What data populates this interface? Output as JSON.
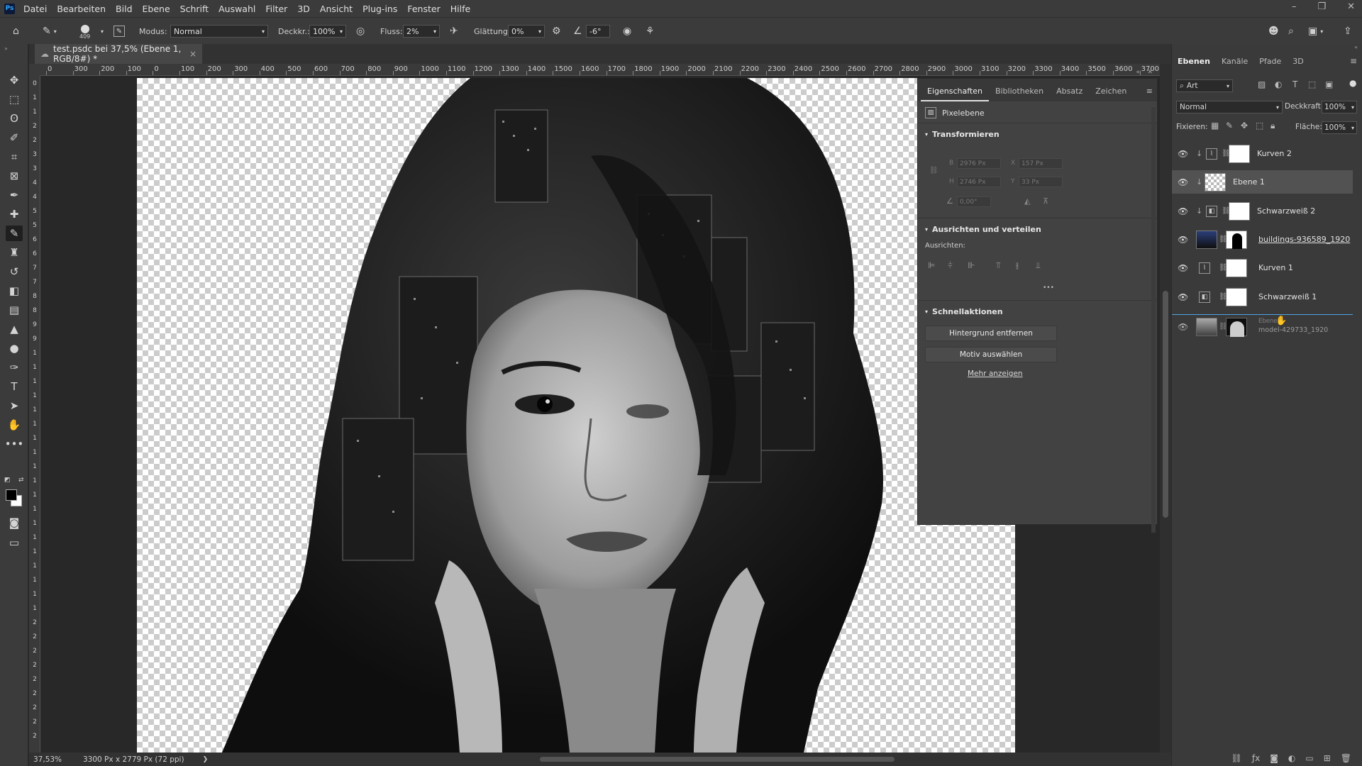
{
  "app": {
    "logo": "Ps"
  },
  "menu": [
    "Datei",
    "Bearbeiten",
    "Bild",
    "Ebene",
    "Schrift",
    "Auswahl",
    "Filter",
    "3D",
    "Ansicht",
    "Plug-ins",
    "Fenster",
    "Hilfe"
  ],
  "window_controls": [
    "–",
    "❐",
    "✕"
  ],
  "options": {
    "brush_size": "409",
    "mode_label": "Modus:",
    "mode_value": "Normal",
    "opacity_label": "Deckkr.:",
    "opacity_value": "100%",
    "flow_label": "Fluss:",
    "flow_value": "2%",
    "smoothing_label": "Glättung:",
    "smoothing_value": "0%",
    "angle_value": "-6°"
  },
  "document": {
    "tab_title": "test.psdc bei 37,5% (Ebene 1, RGB/8#) *",
    "zoom": "37,53%",
    "dimensions": "3300 Px x 2779 Px (72 ppi)"
  },
  "ruler_h": [
    "0",
    "300",
    "200",
    "100",
    "0",
    "100",
    "200",
    "300",
    "400",
    "500",
    "600",
    "700",
    "800",
    "900",
    "1000",
    "1100",
    "1200",
    "1300",
    "1400",
    "1500",
    "1600",
    "1700",
    "1800",
    "1900",
    "2000",
    "2100",
    "2200",
    "2300",
    "2400",
    "2500",
    "2600",
    "2700",
    "2800",
    "2900",
    "3000",
    "3100",
    "3200",
    "3300",
    "3400",
    "3500",
    "3600",
    "3700"
  ],
  "ruler_v": [
    "0",
    "1",
    "1",
    "2",
    "2",
    "3",
    "3",
    "4",
    "4",
    "5",
    "5",
    "6",
    "6",
    "7",
    "7",
    "8",
    "8",
    "9",
    "9",
    "1",
    "1",
    "1",
    "1",
    "1",
    "1",
    "1",
    "1",
    "1",
    "1",
    "1",
    "1",
    "1",
    "1",
    "1",
    "1",
    "1",
    "1",
    "1",
    "2",
    "2",
    "2",
    "2",
    "2",
    "2",
    "2",
    "2",
    "2"
  ],
  "properties": {
    "tabs": [
      "Eigenschaften",
      "Bibliotheken",
      "Absatz",
      "Zeichen"
    ],
    "layer_kind": "Pixelebene",
    "transform_title": "Transformieren",
    "transform_fields": {
      "b": "2976 Px",
      "x": "157 Px",
      "h": "2746 Px",
      "y": "33 Px",
      "angle": "0,00°"
    },
    "align_title": "Ausrichten und verteilen",
    "align_label": "Ausrichten:",
    "more_dots": "•••",
    "quick_title": "Schnellaktionen",
    "btn_remove_bg": "Hintergrund entfernen",
    "btn_select_subject": "Motiv auswählen",
    "more_link": "Mehr anzeigen"
  },
  "layers_panel": {
    "tabs": [
      "Ebenen",
      "Kanäle",
      "Pfade",
      "3D"
    ],
    "filter_value": "Art",
    "blend_mode": "Normal",
    "opacity_label": "Deckkraft:",
    "opacity_value": "100%",
    "lock_label": "Fixieren:",
    "fill_label": "Fläche:",
    "fill_value": "100%",
    "layers": [
      {
        "name": "Kurven 2"
      },
      {
        "name": "Ebene 1"
      },
      {
        "name": "Schwarzweiß 2"
      },
      {
        "name": "buildings-936589_1920"
      },
      {
        "name": "Kurven 1"
      },
      {
        "name": "Schwarzweiß 1"
      },
      {
        "name": "model-429733_1920",
        "ghost_name": "Ebene 1"
      }
    ]
  },
  "colors": {
    "accent": "#31a8ff",
    "panel": "#424242",
    "background": "#282828"
  }
}
